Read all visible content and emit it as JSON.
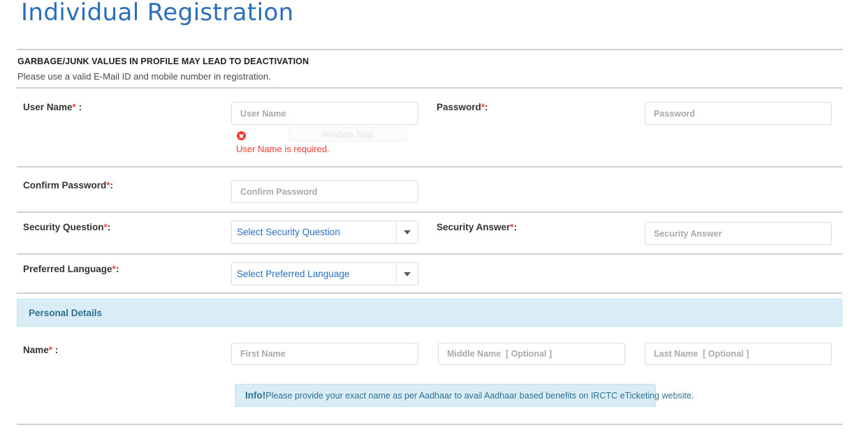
{
  "header": {
    "title": "Individual Registration"
  },
  "notice": {
    "warning": "GARBAGE/JUNK VALUES IN PROFILE MAY LEAD TO DEACTIVATION",
    "instruction": "Please use a valid E-Mail ID and mobile number in registration."
  },
  "form": {
    "user_name": {
      "label": "User Name",
      "required_mark": "*",
      "label_suffix": " :",
      "placeholder": "User Name",
      "value": "",
      "error": "User Name is required.",
      "error_icon": "error-circle-x-icon"
    },
    "password": {
      "label": "Password",
      "required_mark": "*",
      "label_suffix": ":",
      "placeholder": "Password",
      "value": ""
    },
    "confirm_password": {
      "label": "Confirm Password",
      "required_mark": "*",
      "label_suffix": ":",
      "placeholder": "Confirm Password",
      "value": ""
    },
    "security_question": {
      "label": "Security Question",
      "required_mark": "*",
      "label_suffix": ":",
      "selected": "Select Security Question",
      "caret_icon": "chevron-down-icon"
    },
    "security_answer": {
      "label": "Security Answer",
      "required_mark": "*",
      "label_suffix": ":",
      "placeholder": "Security Answer",
      "value": ""
    },
    "preferred_language": {
      "label": "Preferred Language",
      "required_mark": "*",
      "label_suffix": ":",
      "selected": "Select Preferred Language",
      "caret_icon": "chevron-down-icon"
    },
    "personal_details_section": {
      "title": "Personal Details"
    },
    "name": {
      "label": "Name",
      "required_mark": "*",
      "label_suffix": " :",
      "first_placeholder": "First Name",
      "first_value": "",
      "middle_placeholder": "Middle Name  [ Optional ]",
      "middle_value": "",
      "last_placeholder": "Last Name  [ Optional ]",
      "last_value": ""
    },
    "name_info": {
      "label": "Info!",
      "text": "Please provide your exact name as per Aadhaar to avail Aadhaar based benefits on IRCTC eTicketing website."
    }
  },
  "overlay": {
    "snip_label": "Window Snip"
  },
  "colors": {
    "title_blue": "#2a6ebb",
    "required_red": "#e8453c",
    "error_red": "#ef3a33",
    "info_bg": "#d9edf7",
    "info_border": "#bce8f1",
    "info_text": "#31708f",
    "rule_gray": "#cfcfcf"
  }
}
